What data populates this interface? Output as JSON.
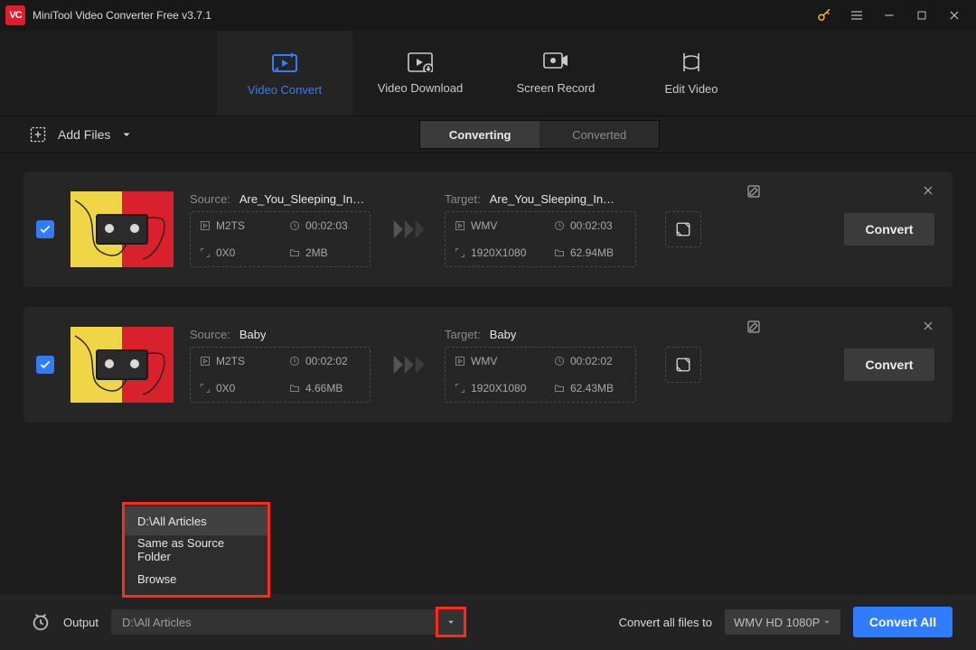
{
  "app": {
    "title": "MiniTool Video Converter Free v3.7.1"
  },
  "tabs": {
    "video_convert": "Video Convert",
    "video_download": "Video Download",
    "screen_record": "Screen Record",
    "edit_video": "Edit Video"
  },
  "toolbar": {
    "add_files": "Add Files",
    "converting": "Converting",
    "converted": "Converted"
  },
  "labels": {
    "source": "Source:",
    "target": "Target:",
    "convert": "Convert",
    "output": "Output",
    "convert_all_to": "Convert all files to",
    "convert_all": "Convert All"
  },
  "items": [
    {
      "source_name": "Are_You_Sleeping_In…",
      "source_format": "M2TS",
      "source_duration": "00:02:03",
      "source_res": "0X0",
      "source_size": "2MB",
      "target_name": "Are_You_Sleeping_In…",
      "target_format": "WMV",
      "target_duration": "00:02:03",
      "target_res": "1920X1080",
      "target_size": "62.94MB"
    },
    {
      "source_name": "Baby",
      "source_format": "M2TS",
      "source_duration": "00:02:02",
      "source_res": "0X0",
      "source_size": "4.66MB",
      "target_name": "Baby",
      "target_format": "WMV",
      "target_duration": "00:02:02",
      "target_res": "1920X1080",
      "target_size": "62.43MB"
    }
  ],
  "output_menu": {
    "opt0": "D:\\All Articles",
    "opt1": "Same as Source Folder",
    "opt2": "Browse"
  },
  "bottom": {
    "output_value": "D:\\All Articles",
    "format_value": "WMV HD 1080P"
  }
}
